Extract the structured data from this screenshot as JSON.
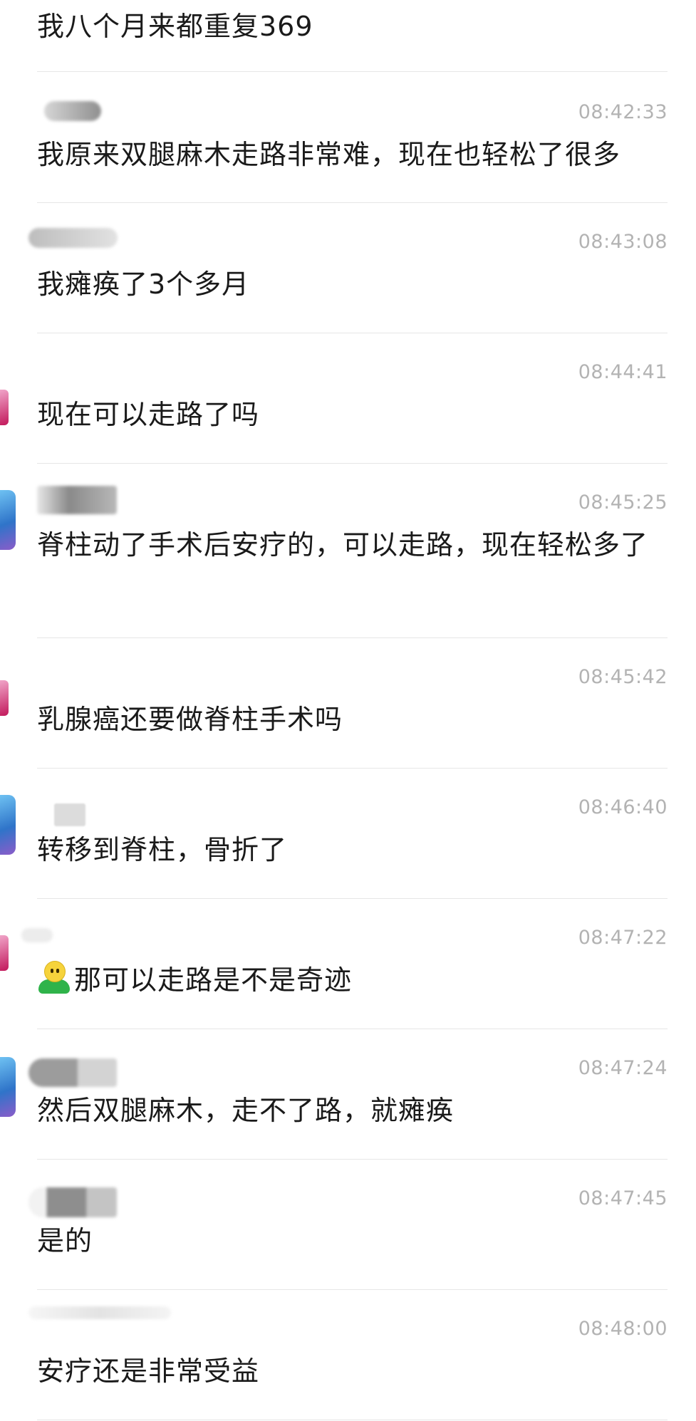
{
  "messages": [
    {
      "text": "我八个月来都重复369",
      "time": ""
    },
    {
      "text": "我原来双腿麻木走路非常难，现在也轻松了很多",
      "time": "08:42:33"
    },
    {
      "text": "我瘫痪了3个多月",
      "time": "08:43:08"
    },
    {
      "text": "现在可以走路了吗",
      "time": "08:44:41"
    },
    {
      "text": "脊柱动了手术后安疗的，可以走路，现在轻松多了",
      "time": "08:45:25"
    },
    {
      "text": "乳腺癌还要做脊柱手术吗",
      "time": "08:45:42"
    },
    {
      "text": "转移到脊柱，骨折了",
      "time": "08:46:40"
    },
    {
      "text": "那可以走路是不是奇迹",
      "time": "08:47:22",
      "emoji": "person-emoji-icon"
    },
    {
      "text": "然后双腿麻木，走不了路，就瘫痪",
      "time": "08:47:24"
    },
    {
      "text": "是的",
      "time": "08:47:45"
    },
    {
      "text": "安疗还是非常受益",
      "time": "08:48:00"
    }
  ],
  "colors": {
    "text": "#1a1a1a",
    "timestamp": "#b3b3b3",
    "divider": "#e6e6e6",
    "background": "#ffffff"
  }
}
